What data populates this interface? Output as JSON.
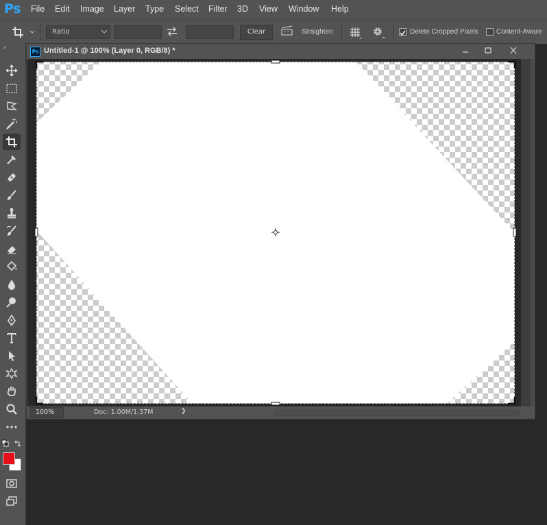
{
  "app": {
    "logo": "Ps"
  },
  "menu": [
    "File",
    "Edit",
    "Image",
    "Layer",
    "Type",
    "Select",
    "Filter",
    "3D",
    "View",
    "Window",
    "Help"
  ],
  "options": {
    "ratio_label": "Ratio",
    "clear_label": "Clear",
    "straighten_label": "Straighten",
    "delete_cropped_label": "Delete Cropped Pixels",
    "delete_cropped_checked": true,
    "content_aware_label": "Content-Aware",
    "content_aware_checked": false
  },
  "document": {
    "badge": "Ps",
    "title": "Untitled-1 @ 100% (Layer 0, RGB/8) *",
    "zoom": "100%",
    "doc_info": "Doc: 1.00M/1.37M",
    "status_arrow": "❯"
  },
  "colors": {
    "foreground": "#e8101a",
    "background": "#ffffff",
    "accent": "#31a8ff"
  },
  "tools": [
    "move-tool",
    "marquee-tool",
    "lasso-tool",
    "magic-wand-tool",
    "crop-tool",
    "eyedropper-tool",
    "healing-brush-tool",
    "brush-tool",
    "clone-stamp-tool",
    "history-brush-tool",
    "eraser-tool",
    "paint-bucket-tool",
    "blur-tool",
    "dodge-tool",
    "pen-tool",
    "type-tool",
    "path-selection-tool",
    "custom-shape-tool",
    "hand-tool",
    "zoom-tool",
    "more-tools"
  ]
}
